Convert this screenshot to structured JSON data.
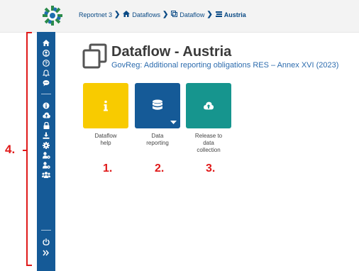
{
  "breadcrumb": {
    "items": [
      {
        "label": "Reportnet 3",
        "icon": ""
      },
      {
        "label": "Dataflows",
        "icon": "home-icon"
      },
      {
        "label": "Dataflow",
        "icon": "clone-icon"
      },
      {
        "label": "Austria",
        "icon": "list-icon"
      }
    ],
    "separator": "❯"
  },
  "sidebar": {
    "icons": [
      "home-icon",
      "user-icon",
      "help-icon",
      "bell-icon",
      "chat-icon",
      "info-icon",
      "cloud-upload-icon",
      "lock-icon",
      "download-icon",
      "settings-icon",
      "user-settings-icon",
      "user-manage-icon",
      "users-icon",
      "power-icon",
      "expand-icon"
    ]
  },
  "page": {
    "title": "Dataflow - Austria",
    "subtitle": "GovReg: Additional reporting obligations RES – Annex XVI (2023)"
  },
  "tiles": [
    {
      "label_line1": "Dataflow",
      "label_line2": "help",
      "label_line3": "",
      "icon": "info-icon",
      "color": "#f8cb00",
      "annotation": "1."
    },
    {
      "label_line1": "Data",
      "label_line2": "reporting",
      "label_line3": "",
      "icon": "database-icon",
      "color": "#155a97",
      "annotation": "2."
    },
    {
      "label_line1": "Release to",
      "label_line2": "data",
      "label_line3": "collection",
      "icon": "cloud-upload-icon",
      "color": "#16958e",
      "annotation": "3."
    }
  ],
  "annotations": {
    "sidebar": "4."
  },
  "colors": {
    "accent": "#155a97",
    "annotation_red": "#e01a1a"
  }
}
